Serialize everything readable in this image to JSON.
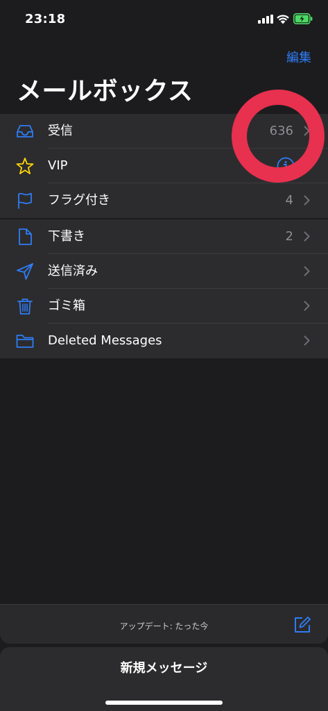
{
  "status_bar": {
    "time": "23:18"
  },
  "header": {
    "edit_label": "編集",
    "title": "メールボックス"
  },
  "mailboxes_primary": [
    {
      "label": "受信",
      "count": "636",
      "icon": "inbox-tray-icon"
    },
    {
      "label": "VIP",
      "count": "",
      "icon": "star-icon",
      "accessory": "info-icon"
    },
    {
      "label": "フラグ付き",
      "count": "4",
      "icon": "flag-icon"
    }
  ],
  "mailboxes_account": [
    {
      "label": "下書き",
      "count": "2",
      "icon": "document-icon"
    },
    {
      "label": "送信済み",
      "count": "",
      "icon": "paper-plane-icon"
    },
    {
      "label": "ゴミ箱",
      "count": "",
      "icon": "trash-icon"
    },
    {
      "label": "Deleted Messages",
      "count": "",
      "icon": "folder-icon"
    }
  ],
  "toolbar": {
    "status": "アップデート: たった今",
    "compose_icon": "compose-icon"
  },
  "sheet": {
    "new_message_label": "新規メッセージ"
  },
  "colors": {
    "background": "#1c1c1e",
    "row_background": "#2c2c2e",
    "accent": "#2f7cf6",
    "vip_star": "#ffd60a",
    "annotation": "#e8304f",
    "battery": "#4cd964"
  }
}
